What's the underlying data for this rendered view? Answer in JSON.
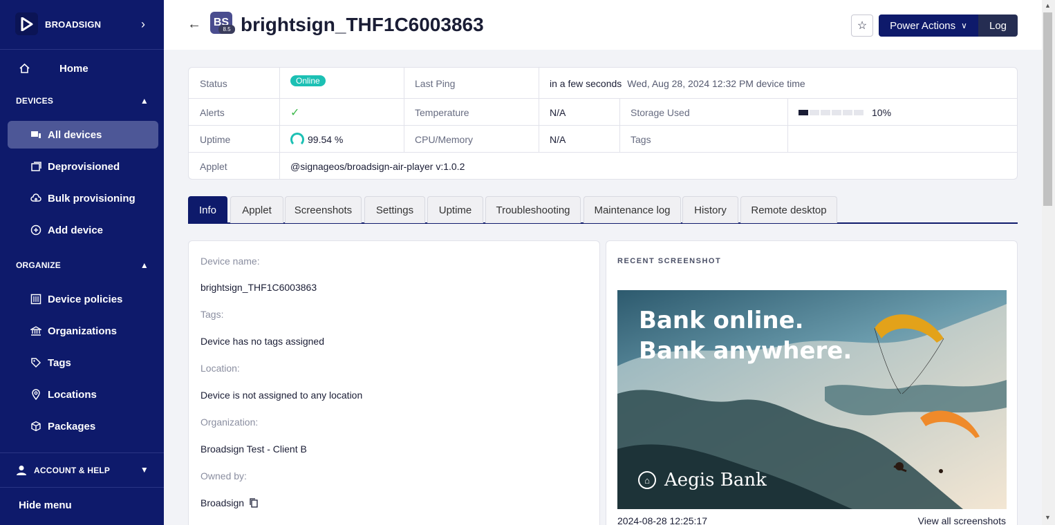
{
  "sidebar": {
    "brand": "BROADSIGN",
    "home": "Home",
    "devices_section": "DEVICES",
    "devices_items": [
      "All devices",
      "Deprovisioned",
      "Bulk provisioning",
      "Add device"
    ],
    "organize_section": "ORGANIZE",
    "organize_items": [
      "Device policies",
      "Organizations",
      "Tags",
      "Locations",
      "Packages"
    ],
    "account": "ACCOUNT & HELP",
    "hide_menu": "Hide menu"
  },
  "header": {
    "badge": "BS",
    "badge_version": "8.5",
    "title": "brightsign_THF1C6003863",
    "power_actions": "Power Actions",
    "log": "Log"
  },
  "status": {
    "status_label": "Status",
    "status_value": "Online",
    "last_ping_label": "Last Ping",
    "last_ping_relative": "in a few seconds",
    "last_ping_time": "Wed, Aug 28, 2024 12:32 PM device time",
    "alerts_label": "Alerts",
    "alerts_value": "✓",
    "temperature_label": "Temperature",
    "temperature_value": "N/A",
    "storage_label": "Storage Used",
    "storage_value": "10%",
    "storage_fraction": 0.1,
    "uptime_label": "Uptime",
    "uptime_value": "99.54 %",
    "cpu_label": "CPU/Memory",
    "cpu_value": "N/A",
    "tags_label": "Tags",
    "applet_label": "Applet",
    "applet_value": "@signageos/broadsign-air-player v:1.0.2"
  },
  "tabs": [
    "Info",
    "Applet",
    "Screenshots",
    "Settings",
    "Uptime",
    "Troubleshooting",
    "Maintenance log",
    "History",
    "Remote desktop"
  ],
  "info": {
    "device_name_label": "Device name:",
    "device_name": "brightsign_THF1C6003863",
    "tags_label": "Tags:",
    "tags_value": "Device has no tags assigned",
    "location_label": "Location:",
    "location_value": "Device is not assigned to any location",
    "organization_label": "Organization:",
    "organization_value": "Broadsign Test - Client B",
    "owned_by_label": "Owned by:",
    "owned_by_value": "Broadsign"
  },
  "screenshot": {
    "title": "RECENT SCREENSHOT",
    "headline_1": "Bank online.",
    "headline_2": "Bank anywhere.",
    "bank_name": "Aegis Bank",
    "date": "2024-08-28 12:25:17",
    "view_all": "View all screenshots"
  },
  "colors": {
    "sidebar_bg": "#0e1a6b",
    "accent": "#0e1a6b",
    "online": "#1cc0b4"
  }
}
